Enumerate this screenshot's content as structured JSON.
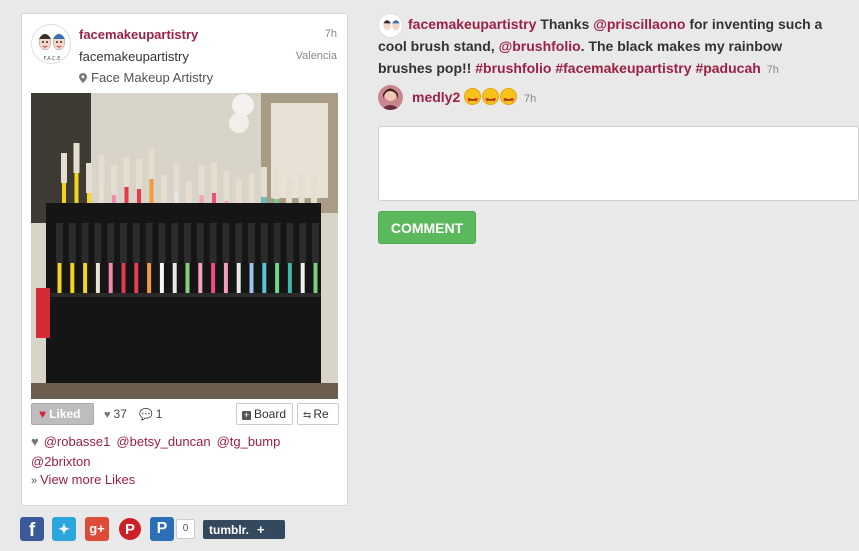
{
  "post": {
    "username": "facemakeupartistry",
    "time_ago": "7h",
    "full_name": "facemakeupartistry",
    "city": "Valencia",
    "location": "Face Makeup Artistry",
    "avatar_text": "F.A.C.E",
    "actions": {
      "liked_label": "Liked",
      "likes_count": "37",
      "comments_count": "1",
      "board_label": "Board",
      "repost_label": "Re"
    },
    "likers": [
      "@robasse1",
      "@betsy_duncan",
      "@tg_bump",
      "@2brixton"
    ],
    "view_more_label": "View more Likes"
  },
  "share": {
    "icons": [
      "facebook-icon",
      "twitter-icon",
      "google-plus-icon",
      "pinterest-icon",
      "pocket-icon",
      "tumblr-icon"
    ],
    "pocket_count": "0",
    "tumblr_label": "tumblr.",
    "tumblr_plus": "+"
  },
  "comments": [
    {
      "user": "facemakeupartistry",
      "parts": [
        {
          "t": "Thanks "
        },
        {
          "t": "@priscillaono",
          "link": true
        },
        {
          "t": " for inventing such a cool brush stand, "
        },
        {
          "t": "@brushfolio",
          "link": true
        },
        {
          "t": ". The black makes my rainbow brushes pop!! "
        },
        {
          "t": "#brushfolio",
          "link": true
        },
        {
          "t": " "
        },
        {
          "t": "#facemakeupartistry",
          "link": true
        },
        {
          "t": " "
        },
        {
          "t": "#paducah",
          "link": true
        }
      ],
      "time_ago": "7h"
    },
    {
      "user": "medly2",
      "emoji_count": 3,
      "emoji_name": "heart-eyes-emoji",
      "time_ago": "7h"
    }
  ],
  "comment_form": {
    "placeholder": "",
    "button_label": "COMMENT"
  },
  "colors": {
    "accent": "#9b2044",
    "comment_button": "#5cb85c",
    "background": "#e9e9e9"
  }
}
